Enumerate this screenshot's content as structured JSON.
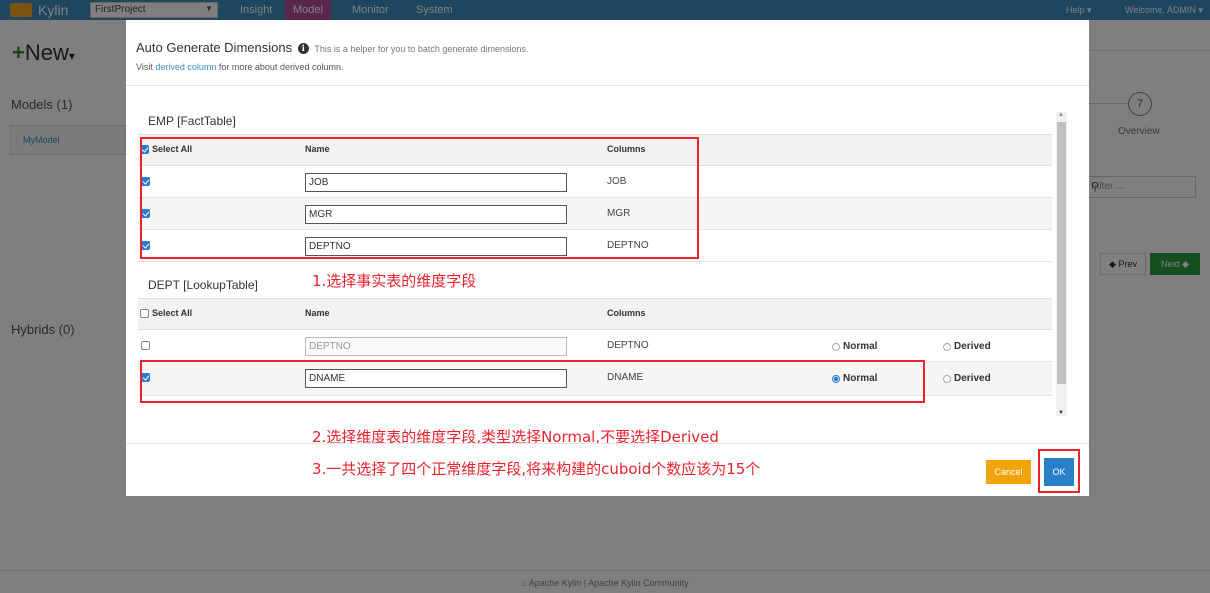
{
  "app": {
    "brand": "Kylin",
    "project": "FirstProject",
    "nav": [
      "Insight",
      "Model",
      "Monitor",
      "System"
    ],
    "help": "Help ▾",
    "welcome": "Welcome, ADMIN ▾",
    "new_label": "New",
    "models_title": "Models (1)",
    "model_name": "MyModel",
    "hybrids_title": "Hybrids (0)",
    "step_number": "7",
    "step_label": "Overview",
    "filter_placeholder": "Filter ...",
    "prev_label": "Prev",
    "next_label": "Next",
    "footer": "Apache Kylin | Apache Kylin Community"
  },
  "modal": {
    "title": "Auto Generate Dimensions",
    "subtitle": "This is a helper for you to batch generate dimensions.",
    "visit_prefix": "Visit",
    "visit_link": "derived column",
    "visit_suffix": "for more about derived column.",
    "fact_section": "EMP [FactTable]",
    "lookup_section": "DEPT [LookupTable]",
    "select_all": "Select All",
    "col_name": "Name",
    "col_columns": "Columns",
    "fact_rows": [
      {
        "name": "JOB",
        "column": "JOB",
        "checked": true
      },
      {
        "name": "MGR",
        "column": "MGR",
        "checked": true
      },
      {
        "name": "DEPTNO",
        "column": "DEPTNO",
        "checked": true
      }
    ],
    "lookup_rows": [
      {
        "name": "DEPTNO",
        "column": "DEPTNO",
        "checked": false,
        "normal": "Normal",
        "derived": "Derived",
        "selected": "none"
      },
      {
        "name": "DNAME",
        "column": "DNAME",
        "checked": true,
        "normal": "Normal",
        "derived": "Derived",
        "selected": "normal"
      }
    ],
    "cancel": "Cancel",
    "ok": "OK"
  },
  "annotations": {
    "step1": "1.选择事实表的维度字段",
    "step2": "2.选择维度表的维度字段,类型选择Normal,不要选择Derived",
    "step3": "3.一共选择了四个正常维度字段,将来构建的cuboid个数应该为15个"
  },
  "colors": {
    "accent": "#3c8dbc",
    "annotation_red": "#e8232e",
    "ok_blue": "#2a80c8",
    "cancel_orange": "#f0a30a"
  }
}
